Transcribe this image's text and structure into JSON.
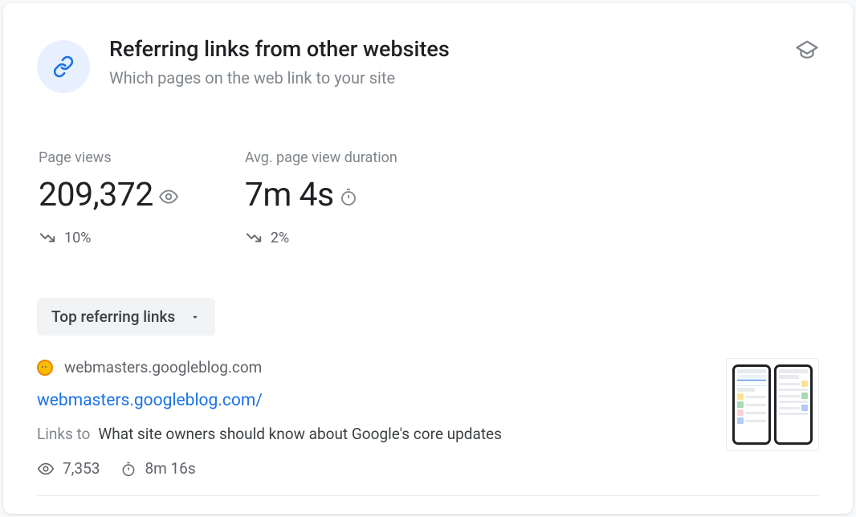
{
  "header": {
    "title": "Referring links from other websites",
    "subtitle": "Which pages on the web link to your site"
  },
  "metrics": {
    "page_views": {
      "label": "Page views",
      "value": "209,372",
      "trend_delta": "10%",
      "trend_direction": "down"
    },
    "avg_duration": {
      "label": "Avg. page view duration",
      "value": "7m 4s",
      "trend_delta": "2%",
      "trend_direction": "down"
    }
  },
  "dropdown": {
    "selected": "Top referring links"
  },
  "referrer": {
    "domain": "webmasters.googleblog.com",
    "url": "webmasters.googleblog.com/",
    "links_to_label": "Links to",
    "links_to_title": "What site owners should know about Google's core updates",
    "views": "7,353",
    "duration": "8m 16s"
  }
}
